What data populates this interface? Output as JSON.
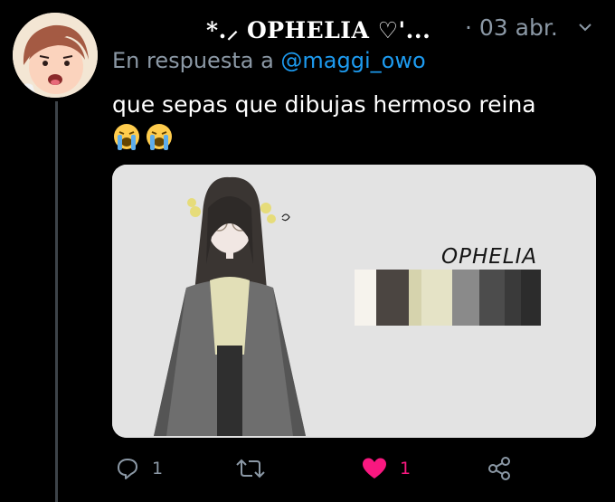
{
  "tweet": {
    "display_name": "*.⸝ OPHELIA ♡'...",
    "separator_date": "· 03 abr.",
    "reply_prefix": "En respuesta a",
    "reply_mention": "@maggi_owo",
    "text": "que sepas que dibujas hermoso reina",
    "emojis": [
      "loudly-crying-face",
      "loudly-crying-face"
    ]
  },
  "media": {
    "title": "OPHELIA",
    "palette": [
      "#f6f3ed",
      "#4b4541",
      "#d6d3ad",
      "#e5e3c6",
      "#8a8a8a",
      "#4c4c4c",
      "#3a3a3a",
      "#2c2c2c"
    ]
  },
  "actions": {
    "reply_count": "1",
    "retweet_count": "",
    "like_count": "1",
    "like_color": "#f91880",
    "icon_color": "#8b98a5"
  },
  "colors": {
    "background": "#000000",
    "link": "#1d9bf0",
    "secondary": "#8b98a5"
  }
}
